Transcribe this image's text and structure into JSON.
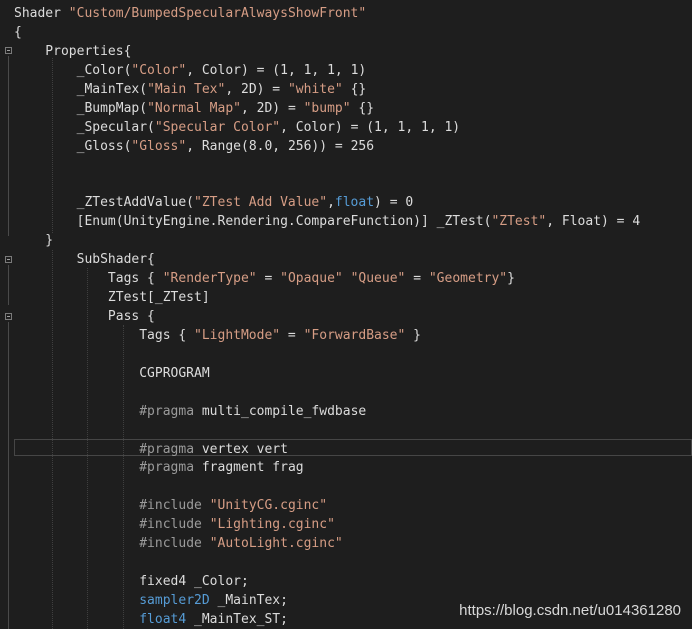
{
  "lines": [
    [
      "Shader ",
      "\"Custom/BumpedSpecularAlwaysShowFront\""
    ],
    [
      "{"
    ],
    [
      "    Properties{"
    ],
    [
      "        _Color(",
      "\"Color\"",
      ", Color) = (1, 1, 1, 1)"
    ],
    [
      "        _MainTex(",
      "\"Main Tex\"",
      ", 2D) = ",
      "\"white\"",
      " {}"
    ],
    [
      "        _BumpMap(",
      "\"Normal Map\"",
      ", 2D) = ",
      "\"bump\"",
      " {}"
    ],
    [
      "        _Specular(",
      "\"Specular Color\"",
      ", Color) = (1, 1, 1, 1)"
    ],
    [
      "        _Gloss(",
      "\"Gloss\"",
      ", Range(8.0, 256)) = 256"
    ],
    [
      ""
    ],
    [
      ""
    ],
    [
      "        _ZTestAddValue(",
      "\"ZTest Add Value\"",
      ",",
      "float",
      ") = 0"
    ],
    [
      "        [Enum(UnityEngine.Rendering.CompareFunction)] _ZTest(",
      "\"ZTest\"",
      ", Float) = 4"
    ],
    [
      "    }"
    ],
    [
      "        SubShader{"
    ],
    [
      "            Tags { ",
      "\"RenderType\"",
      " = ",
      "\"Opaque\"",
      " ",
      "\"Queue\"",
      " = ",
      "\"Geometry\"",
      "}"
    ],
    [
      "            ZTest[_ZTest]"
    ],
    [
      "            Pass {"
    ],
    [
      "                Tags { ",
      "\"LightMode\"",
      " = ",
      "\"ForwardBase\"",
      " }"
    ],
    [
      ""
    ],
    [
      "                CGPROGRAM"
    ],
    [
      ""
    ],
    [
      "                ",
      "#pragma",
      " multi_compile_fwdbase"
    ],
    [
      ""
    ],
    [
      "                ",
      "#pragma",
      " vertex vert"
    ],
    [
      "                ",
      "#pragma",
      " fragment frag"
    ],
    [
      ""
    ],
    [
      "                ",
      "#include",
      " ",
      "\"UnityCG.cginc\""
    ],
    [
      "                ",
      "#include",
      " ",
      "\"Lighting.cginc\""
    ],
    [
      "                ",
      "#include",
      " ",
      "\"AutoLight.cginc\""
    ],
    [
      ""
    ],
    [
      "                fixed4 _Color;"
    ],
    [
      "                ",
      "sampler2D",
      " _MainTex;"
    ],
    [
      "                ",
      "float4",
      " _MainTex_ST;"
    ]
  ],
  "watermark": "https://blog.csdn.net/u014361280"
}
